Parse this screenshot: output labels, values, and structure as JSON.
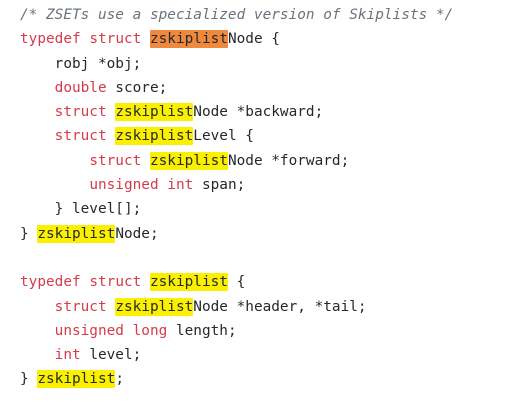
{
  "code": {
    "search_term": "zskiplist",
    "lines": [
      [
        {
          "t": "/* ZSETs use a specialized version of Skiplists */",
          "c": "comment"
        }
      ],
      [
        {
          "t": "typedef",
          "c": "keyword"
        },
        {
          "t": " "
        },
        {
          "t": "struct",
          "c": "keyword"
        },
        {
          "t": " "
        },
        {
          "t": "zskiplist",
          "h": "current"
        },
        {
          "t": "Node {"
        }
      ],
      [
        {
          "t": "    robj *obj;"
        }
      ],
      [
        {
          "t": "    "
        },
        {
          "t": "double",
          "c": "keyword"
        },
        {
          "t": " score;"
        }
      ],
      [
        {
          "t": "    "
        },
        {
          "t": "struct",
          "c": "keyword"
        },
        {
          "t": " "
        },
        {
          "t": "zskiplist",
          "h": "match"
        },
        {
          "t": "Node *backward;"
        }
      ],
      [
        {
          "t": "    "
        },
        {
          "t": "struct",
          "c": "keyword"
        },
        {
          "t": " "
        },
        {
          "t": "zskiplist",
          "h": "match"
        },
        {
          "t": "Level {"
        }
      ],
      [
        {
          "t": "        "
        },
        {
          "t": "struct",
          "c": "keyword"
        },
        {
          "t": " "
        },
        {
          "t": "zskiplist",
          "h": "match"
        },
        {
          "t": "Node *forward;"
        }
      ],
      [
        {
          "t": "        "
        },
        {
          "t": "unsigned",
          "c": "keyword"
        },
        {
          "t": " "
        },
        {
          "t": "int",
          "c": "keyword"
        },
        {
          "t": " span;"
        }
      ],
      [
        {
          "t": "    } level[];"
        }
      ],
      [
        {
          "t": "} "
        },
        {
          "t": "zskiplist",
          "h": "match"
        },
        {
          "t": "Node;"
        }
      ],
      [
        {
          "t": ""
        }
      ],
      [
        {
          "t": "typedef",
          "c": "keyword"
        },
        {
          "t": " "
        },
        {
          "t": "struct",
          "c": "keyword"
        },
        {
          "t": " "
        },
        {
          "t": "zskiplist",
          "h": "match"
        },
        {
          "t": " {"
        }
      ],
      [
        {
          "t": "    "
        },
        {
          "t": "struct",
          "c": "keyword"
        },
        {
          "t": " "
        },
        {
          "t": "zskiplist",
          "h": "match"
        },
        {
          "t": "Node *header, *tail;"
        }
      ],
      [
        {
          "t": "    "
        },
        {
          "t": "unsigned",
          "c": "keyword"
        },
        {
          "t": " "
        },
        {
          "t": "long",
          "c": "keyword"
        },
        {
          "t": " length;"
        }
      ],
      [
        {
          "t": "    "
        },
        {
          "t": "int",
          "c": "keyword"
        },
        {
          "t": " level;"
        }
      ],
      [
        {
          "t": "} "
        },
        {
          "t": "zskiplist",
          "h": "match"
        },
        {
          "t": ";"
        }
      ]
    ]
  },
  "colors": {
    "keyword": "#d73a49",
    "comment": "#6a737d",
    "text": "#24292e",
    "match_highlight": "#fbf000",
    "current_match_highlight": "#f0883e"
  }
}
